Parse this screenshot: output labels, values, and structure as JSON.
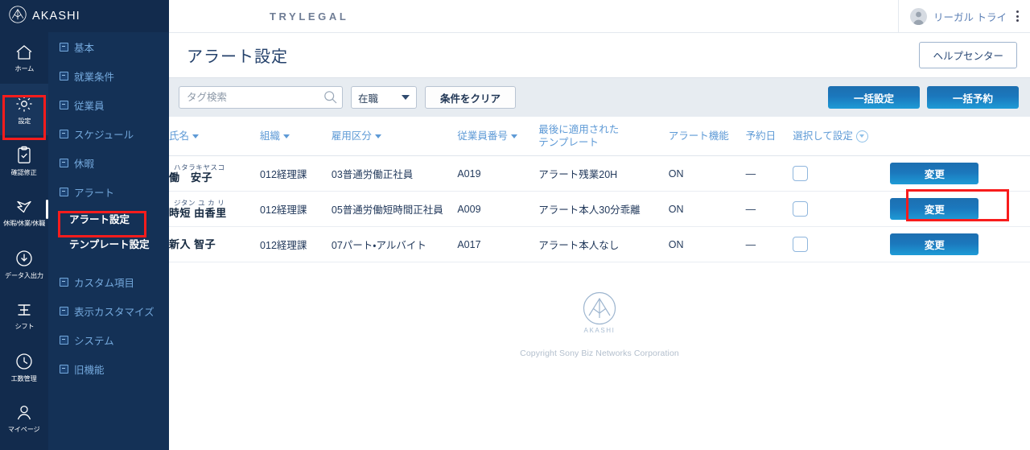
{
  "brand": {
    "logo_text": "AKASHI",
    "tenant_name": "TRYLEGAL"
  },
  "header": {
    "user_name": "リーガル トライ",
    "avatar_icon": "user-avatar-icon",
    "menu_icon": "kebab-menu-icon"
  },
  "icon_rail": {
    "items": [
      {
        "label": "ホーム",
        "icon": "home-icon",
        "active": false
      },
      {
        "label": "設定",
        "icon": "gear-icon",
        "active": true
      },
      {
        "label": "確認修正",
        "icon": "clipboard-check-icon",
        "active": false
      },
      {
        "label": "休暇/休業/休職",
        "icon": "bird-leave-icon",
        "active": false
      },
      {
        "label": "データ入出力",
        "icon": "download-circle-icon",
        "active": false
      },
      {
        "label": "シフト",
        "icon": "shift-icon",
        "active": false
      },
      {
        "label": "工数管理",
        "icon": "clock-icon",
        "active": false
      },
      {
        "label": "マイページ",
        "icon": "person-icon",
        "active": false
      }
    ]
  },
  "nav": {
    "groups": [
      {
        "label": "基本",
        "icon": "expand-box-icon"
      },
      {
        "label": "就業条件",
        "icon": "expand-box-icon"
      },
      {
        "label": "従業員",
        "icon": "expand-box-icon"
      },
      {
        "label": "スケジュール",
        "icon": "expand-box-icon"
      },
      {
        "label": "休暇",
        "icon": "expand-box-icon"
      },
      {
        "label": "アラート",
        "icon": "collapse-box-icon"
      }
    ],
    "alert_children": [
      {
        "label": "アラート設定",
        "selected": true
      },
      {
        "label": "テンプレート設定",
        "selected": false
      }
    ],
    "groups_after": [
      {
        "label": "カスタム項目",
        "icon": "expand-box-icon"
      },
      {
        "label": "表示カスタマイズ",
        "icon": "expand-box-icon"
      },
      {
        "label": "システム",
        "icon": "expand-box-icon"
      },
      {
        "label": "旧機能",
        "icon": "expand-box-icon"
      }
    ]
  },
  "page": {
    "title": "アラート設定",
    "help_button": "ヘルプセンター"
  },
  "filters": {
    "search_placeholder": "タグ検索",
    "search_value": "",
    "search_icon": "search-icon",
    "status_select": "在職",
    "status_caret_icon": "chevron-down-icon",
    "clear_button": "条件をクリア",
    "bulk_set_button": "一括設定",
    "bulk_reserve_button": "一括予約"
  },
  "table": {
    "columns": [
      {
        "label": "氏名",
        "sortable": true,
        "icon": "sort-caret-icon"
      },
      {
        "label": "組織",
        "sortable": true,
        "icon": "sort-caret-icon"
      },
      {
        "label": "雇用区分",
        "sortable": true,
        "icon": "sort-caret-icon"
      },
      {
        "label": "従業員番号",
        "sortable": true,
        "icon": "sort-caret-icon"
      },
      {
        "label_line1": "最後に適用された",
        "label_line2": "テンプレート",
        "sortable": false
      },
      {
        "label": "アラート機能",
        "sortable": false
      },
      {
        "label": "予約日",
        "sortable": false
      },
      {
        "label": "選択して設定",
        "sortable": false,
        "icon": "circle-chevron-down-icon"
      }
    ],
    "rows": [
      {
        "kana": "ハタラキヤスコ",
        "name": "働　安子",
        "org": "012経理課",
        "employment_type": "03普通労働正社員",
        "employee_no": "A019",
        "last_template": "アラート残業20H",
        "alert_function": "ON",
        "reserved_date": "—",
        "checked": false,
        "action_button": "変更",
        "highlighted": false
      },
      {
        "kana": "ジタン ユ カ リ",
        "name": "時短 由香里",
        "org": "012経理課",
        "employment_type": "05普通労働短時間正社員",
        "employee_no": "A009",
        "last_template": "アラート本人30分乖離",
        "alert_function": "ON",
        "reserved_date": "—",
        "checked": false,
        "action_button": "変更",
        "highlighted": true
      },
      {
        "kana": "",
        "name": "新入 智子",
        "org": "012経理課",
        "employment_type": "07パート・アルバイト",
        "employee_no": "A017",
        "last_template": "アラート本人なし",
        "alert_function": "ON",
        "reserved_date": "—",
        "checked": false,
        "action_button": "変更",
        "highlighted": false
      }
    ]
  },
  "footer": {
    "logo_text": "AKASHI",
    "copyright": "Copyright Sony Biz Networks Corporation"
  },
  "colors": {
    "sidebar_dark": "#122b4d",
    "sidebar_mid": "#143156",
    "accent_blue": "#1b77bc",
    "link_blue": "#5e9ad6",
    "highlight_red": "#f81c1c",
    "filter_bg": "#e7ecf1"
  }
}
